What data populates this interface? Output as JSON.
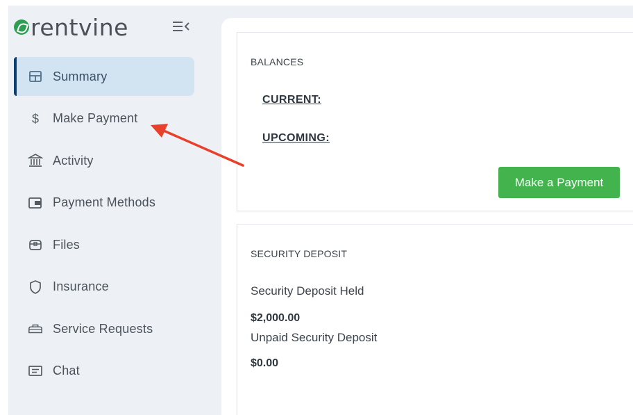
{
  "brand": {
    "name": "rentvine",
    "accent": "#2e9e55"
  },
  "sidebar": {
    "items": [
      {
        "label": "Summary",
        "icon": "layout-icon",
        "active": true
      },
      {
        "label": "Make Payment",
        "icon": "dollar-icon"
      },
      {
        "label": "Activity",
        "icon": "bank-icon"
      },
      {
        "label": "Payment Methods",
        "icon": "wallet-icon"
      },
      {
        "label": "Files",
        "icon": "folder-icon"
      },
      {
        "label": "Insurance",
        "icon": "shield-icon"
      },
      {
        "label": "Service Requests",
        "icon": "toolbox-icon"
      },
      {
        "label": "Chat",
        "icon": "chat-icon"
      }
    ]
  },
  "balances": {
    "title": "BALANCES",
    "current_label": "CURRENT:",
    "upcoming_label": "UPCOMING:",
    "pay_button": "Make a Payment"
  },
  "deposit": {
    "title": "SECURITY DEPOSIT",
    "held_label": "Security Deposit Held",
    "held_value": "$2,000.00",
    "unpaid_label": "Unpaid Security Deposit",
    "unpaid_value": "$0.00"
  },
  "colors": {
    "active_bg": "#d2e4f2",
    "active_bar": "#0c3e6f",
    "button_green": "#43b34e",
    "arrow_red": "#e8402a"
  }
}
